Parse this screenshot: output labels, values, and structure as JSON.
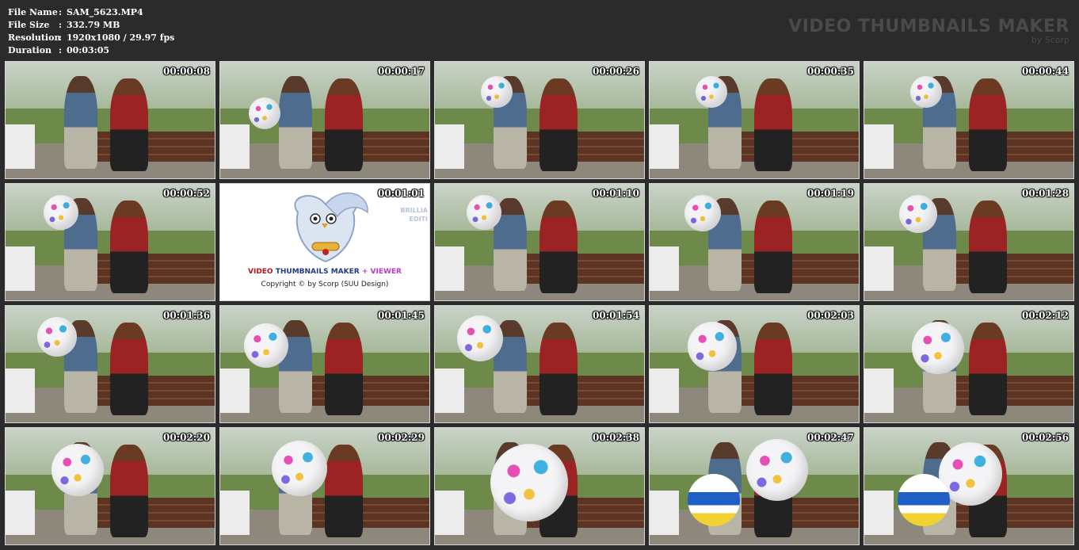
{
  "file_info": [
    {
      "key": "File Name",
      "value": "SAM_5623.MP4"
    },
    {
      "key": "File Size",
      "value": "332.79 MB"
    },
    {
      "key": "Resolution",
      "value": "1920x1080 / 29.97 fps"
    },
    {
      "key": "Duration",
      "value": "00:03:05"
    }
  ],
  "colon": ":",
  "brand": {
    "title": "VIDEO THUMBNAILS MAKER",
    "subtitle": "by Scorp"
  },
  "thumbnails": [
    {
      "time": "00:00:08",
      "scene": "bench"
    },
    {
      "time": "00:00:17",
      "scene": "bench"
    },
    {
      "time": "00:00:26",
      "scene": "bench"
    },
    {
      "time": "00:00:35",
      "scene": "bench"
    },
    {
      "time": "00:00:44",
      "scene": "bench"
    },
    {
      "time": "00:00:52",
      "scene": "bench"
    },
    {
      "time": "00:01:01",
      "scene": "promo"
    },
    {
      "time": "00:01:10",
      "scene": "bench"
    },
    {
      "time": "00:01:19",
      "scene": "bench"
    },
    {
      "time": "00:01:28",
      "scene": "bench"
    },
    {
      "time": "00:01:36",
      "scene": "bench"
    },
    {
      "time": "00:01:45",
      "scene": "bench"
    },
    {
      "time": "00:01:54",
      "scene": "bench"
    },
    {
      "time": "00:02:03",
      "scene": "bench"
    },
    {
      "time": "00:02:12",
      "scene": "bench"
    },
    {
      "time": "00:02:20",
      "scene": "bench"
    },
    {
      "time": "00:02:29",
      "scene": "bench"
    },
    {
      "time": "00:02:38",
      "scene": "closeup"
    },
    {
      "time": "00:02:47",
      "scene": "closeup"
    },
    {
      "time": "00:02:56",
      "scene": "closeup"
    }
  ],
  "promo": {
    "part1": "VIDEO ",
    "part2": "THUMBNAILS MAKER ",
    "part3": "+ VIEWER",
    "copyright": "Copyright © by Scorp (SUU Design)",
    "side1": "BRILLIA",
    "side2": "EDITI"
  },
  "colors": {
    "background": "#2b2b2b",
    "brand_text": "#4a4a4a",
    "timestamp": "#ffffff"
  }
}
